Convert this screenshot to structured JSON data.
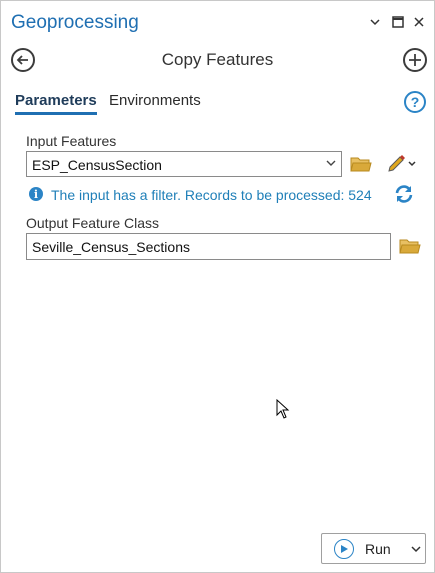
{
  "pane": {
    "title": "Geoprocessing"
  },
  "header": {
    "tool_title": "Copy Features"
  },
  "tabs": [
    {
      "label": "Parameters",
      "active": true
    },
    {
      "label": "Environments",
      "active": false
    }
  ],
  "help": {
    "glyph": "?"
  },
  "params": {
    "input_label": "Input Features",
    "input_value": "ESP_CensusSection",
    "filter_message": "The input has a filter. Records to be processed: 524",
    "output_label": "Output Feature Class",
    "output_value": "Seville_Census_Sections"
  },
  "run": {
    "label": "Run"
  },
  "colors": {
    "accent": "#1f6fb2",
    "info": "#2b84c6",
    "folder": "#d9a93a"
  },
  "icons": {
    "title_controls": [
      "chevron-down-icon",
      "maximize-icon",
      "close-icon"
    ],
    "nav": [
      "back-arrow-icon",
      "add-icon"
    ],
    "input": [
      "folder-icon",
      "pencil-icon"
    ],
    "message": [
      "info-icon",
      "refresh-icon"
    ]
  }
}
